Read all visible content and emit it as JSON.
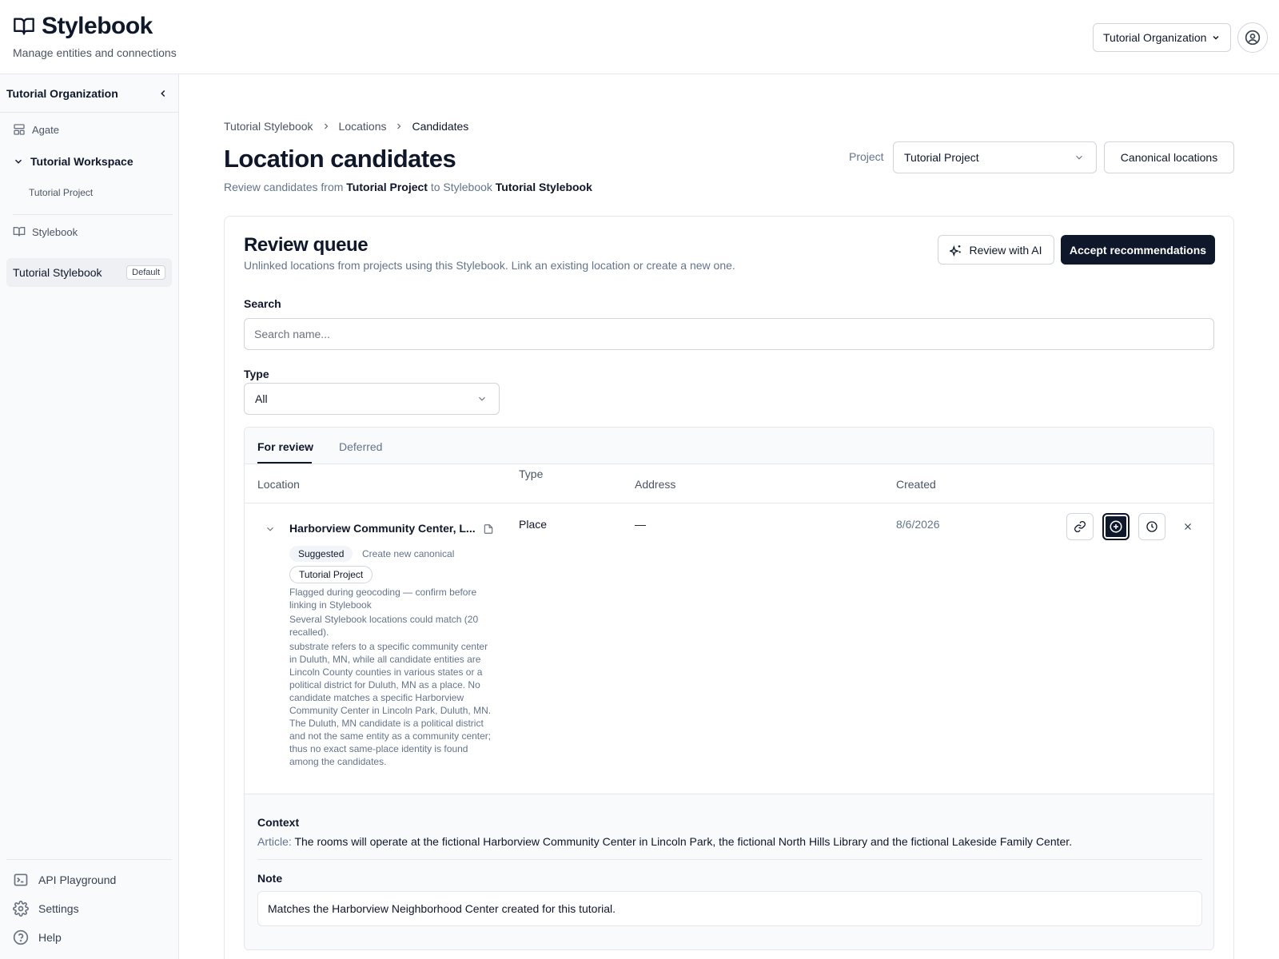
{
  "app": {
    "title": "Stylebook",
    "subtitle": "Manage entities and connections",
    "org_selector": "Tutorial Organization"
  },
  "sidebar": {
    "org_name": "Tutorial Organization",
    "agate_label": "Agate",
    "workspace": "Tutorial Workspace",
    "project": "Tutorial Project",
    "stylebook_label": "Stylebook",
    "active_stylebook": "Tutorial Stylebook",
    "default_badge": "Default",
    "bottom": {
      "api": "API Playground",
      "settings": "Settings",
      "help": "Help"
    }
  },
  "breadcrumbs": [
    "Tutorial Stylebook",
    "Locations",
    "Candidates"
  ],
  "page": {
    "title": "Location candidates",
    "sub_prefix": "Review candidates from",
    "sub_project": "Tutorial Project",
    "sub_mid": "to Stylebook",
    "sub_stylebook": "Tutorial Stylebook",
    "project_label": "Project",
    "project_value": "Tutorial Project",
    "canonical_button": "Canonical locations"
  },
  "queue": {
    "title": "Review queue",
    "subtitle": "Unlinked locations from projects using this Stylebook. Link an existing location or create a new one.",
    "review_ai": "Review with AI",
    "accept": "Accept recommendations",
    "search_label": "Search",
    "search_placeholder": "Search name...",
    "type_label": "Type",
    "type_value": "All",
    "tabs": [
      "For review",
      "Deferred"
    ],
    "columns": [
      "Location",
      "Type",
      "Address",
      "Created"
    ]
  },
  "row": {
    "name": "Harborview Community Center, L...",
    "suggested_chip": "Suggested",
    "create_link": "Create new canonical",
    "project_chip": "Tutorial Project",
    "note1": "Flagged during geocoding — confirm before linking in Stylebook",
    "note2": "Several Stylebook locations could match (20 recalled).",
    "note3": "substrate refers to a specific community center in Duluth, MN, while all candidate entities are Lincoln County counties in various states or a political district for Duluth, MN as a place. No candidate matches a specific Harborview Community Center in Lincoln Park, Duluth, MN. The Duluth, MN candidate is a political district and not the same entity as a community center; thus no exact same-place identity is found among the candidates.",
    "type": "Place",
    "address": "—",
    "created": "8/6/2026"
  },
  "context": {
    "title": "Context",
    "article_label": "Article:",
    "article_text": "The rooms will operate at the fictional Harborview Community Center in Lincoln Park, the fictional North Hills Library and the fictional Lakeside Family Center.",
    "note_title": "Note",
    "note_text": "Matches the Harborview Neighborhood Center created for this tutorial."
  },
  "icons": {
    "brand": "book-open-icon",
    "avatar": "user-circle-icon",
    "row_actions": [
      "link-icon",
      "plus-circle-icon",
      "clock-icon",
      "close-icon"
    ]
  },
  "colors": {
    "primary": "#0f172a",
    "muted": "#64748b",
    "border": "#e5e7eb",
    "sidebar_bg": "#f8fafc"
  }
}
